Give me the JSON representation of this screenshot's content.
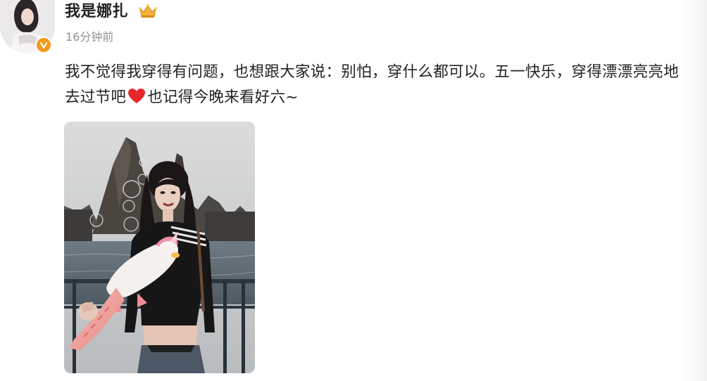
{
  "post": {
    "username": "我是娜扎",
    "timestamp": "16分钟前",
    "text_before_heart": "我不觉得我穿得有问题，也想跟大家说：别怕，穿什么都可以。五一快乐，穿得漂漂亮亮地去过节吧",
    "text_after_heart": "也记得今晚来看好六~"
  },
  "icons": {
    "avatar": "avatar",
    "verified_badge": "verified-icon",
    "member_badge": "crown-icon",
    "emoji": "red-heart-icon"
  },
  "colors": {
    "verified": "#f39a1b",
    "crown": "#f0a630",
    "heart": "#e8272d",
    "timestamp": "#939393"
  }
}
